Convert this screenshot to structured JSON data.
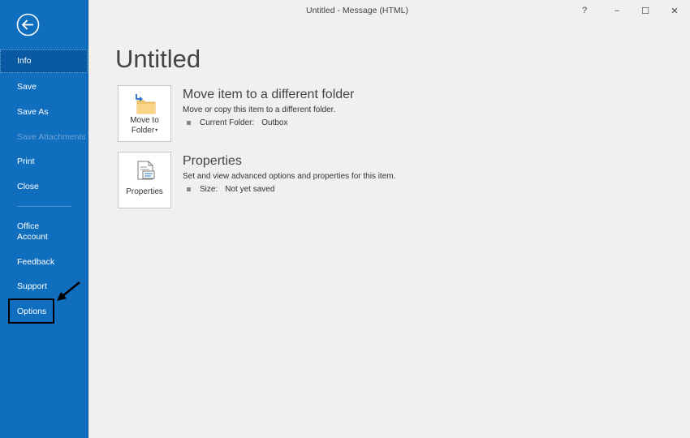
{
  "window": {
    "title": "Untitled  -  Message (HTML)",
    "help_glyph": "?",
    "minimize_glyph": "–",
    "maximize_glyph": "☐",
    "close_glyph": "✕"
  },
  "sidebar": {
    "back_icon": "back-arrow-icon",
    "items": {
      "info": "Info",
      "save": "Save",
      "save_as": "Save As",
      "save_attachments": "Save Attachments",
      "print": "Print",
      "close": "Close",
      "office_account_line1": "Office",
      "office_account_line2": "Account",
      "feedback": "Feedback",
      "support": "Support",
      "options": "Options"
    },
    "colors": {
      "background": "#106ebe",
      "active": "#0a5aa3",
      "disabled_text": "#6ea4d6"
    }
  },
  "main": {
    "page_title": "Untitled",
    "move": {
      "tile_label_line1": "Move to",
      "tile_label_line2": "Folder",
      "dropdown_glyph": "▾",
      "icon": "folder-move-icon",
      "heading": "Move item to a different folder",
      "description": "Move or copy this item to a different folder.",
      "detail_label": "Current Folder:",
      "detail_value": "Outbox"
    },
    "properties": {
      "tile_label": "Properties",
      "icon": "properties-document-icon",
      "heading": "Properties",
      "description": "Set and view advanced options and properties for this item.",
      "detail_label": "Size:",
      "detail_value": "Not yet saved"
    }
  }
}
